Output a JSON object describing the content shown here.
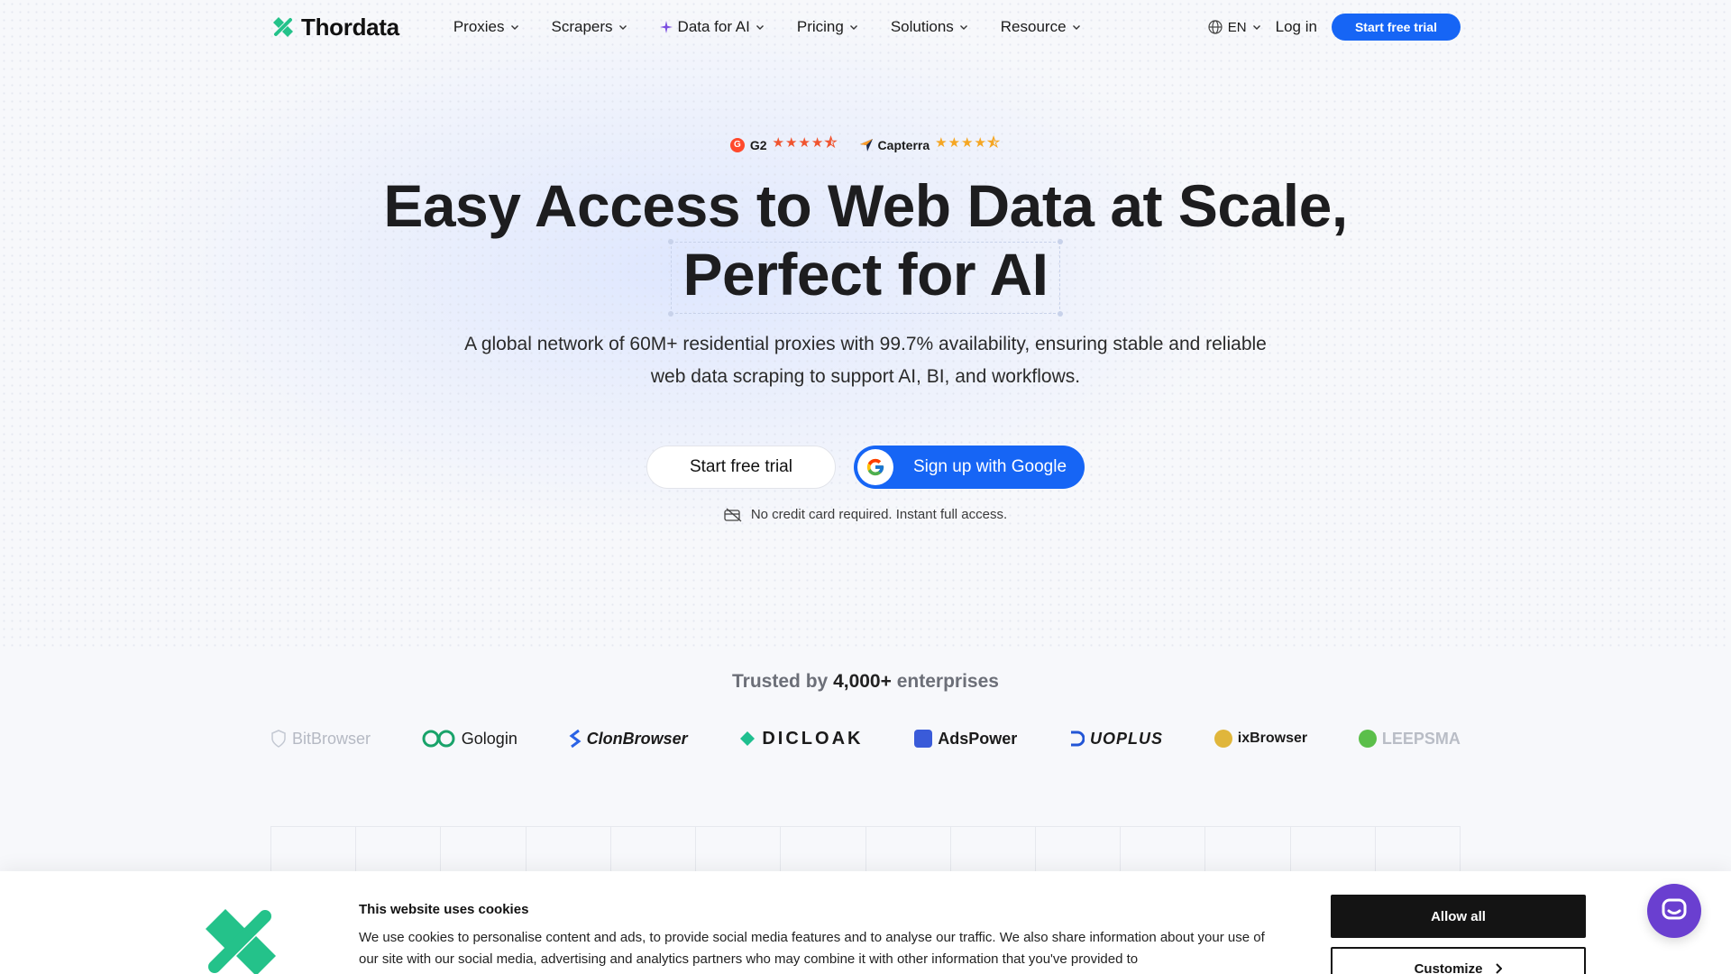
{
  "brand": {
    "name": "Thordata",
    "accent": "#1665f5",
    "logo_color": "#24c28a"
  },
  "nav": {
    "items": [
      {
        "label": "Proxies",
        "icon": ""
      },
      {
        "label": "Scrapers",
        "icon": ""
      },
      {
        "label": "Data for AI",
        "icon": "sparkle-icon"
      },
      {
        "label": "Pricing",
        "icon": ""
      },
      {
        "label": "Solutions",
        "icon": ""
      },
      {
        "label": "Resource",
        "icon": ""
      }
    ],
    "language": "EN",
    "login": "Log in",
    "cta": "Start free trial"
  },
  "ratings": [
    {
      "name": "G2",
      "stars": "★★★★⯪",
      "rating": 4.5
    },
    {
      "name": "Capterra",
      "stars": "★★★★⯪",
      "rating": 4.5
    }
  ],
  "hero": {
    "title_line1": "Easy Access to Web Data at Scale,",
    "title_line2": "Perfect for AI",
    "subtitle_line1": "A global network of 60M+ residential proxies with 99.7% availability, ensuring stable and reliable",
    "subtitle_line2": "web data scraping to support AI, BI, and workflows.",
    "primary_cta": "Start free trial",
    "google_cta": "Sign up with Google",
    "note": "No credit card required. Instant full access."
  },
  "trusted": {
    "prefix": "Trusted by",
    "count": "4,000+",
    "suffix": "enterprises",
    "logos": [
      "BitBrowser",
      "Gologin",
      "ClonBrowser",
      "DICLOAK",
      "AdsPower",
      "UOPLUS",
      "ixBrowser",
      "LEEPSMA"
    ]
  },
  "cookie": {
    "title": "This website uses cookies",
    "text": "We use cookies to personalise content and ads, to provide social media features and to analyse our traffic. We also share information about your use of our site with our social media, advertising and analytics partners who may combine it with other information that you've provided to",
    "allow": "Allow all",
    "customize": "Customize"
  }
}
